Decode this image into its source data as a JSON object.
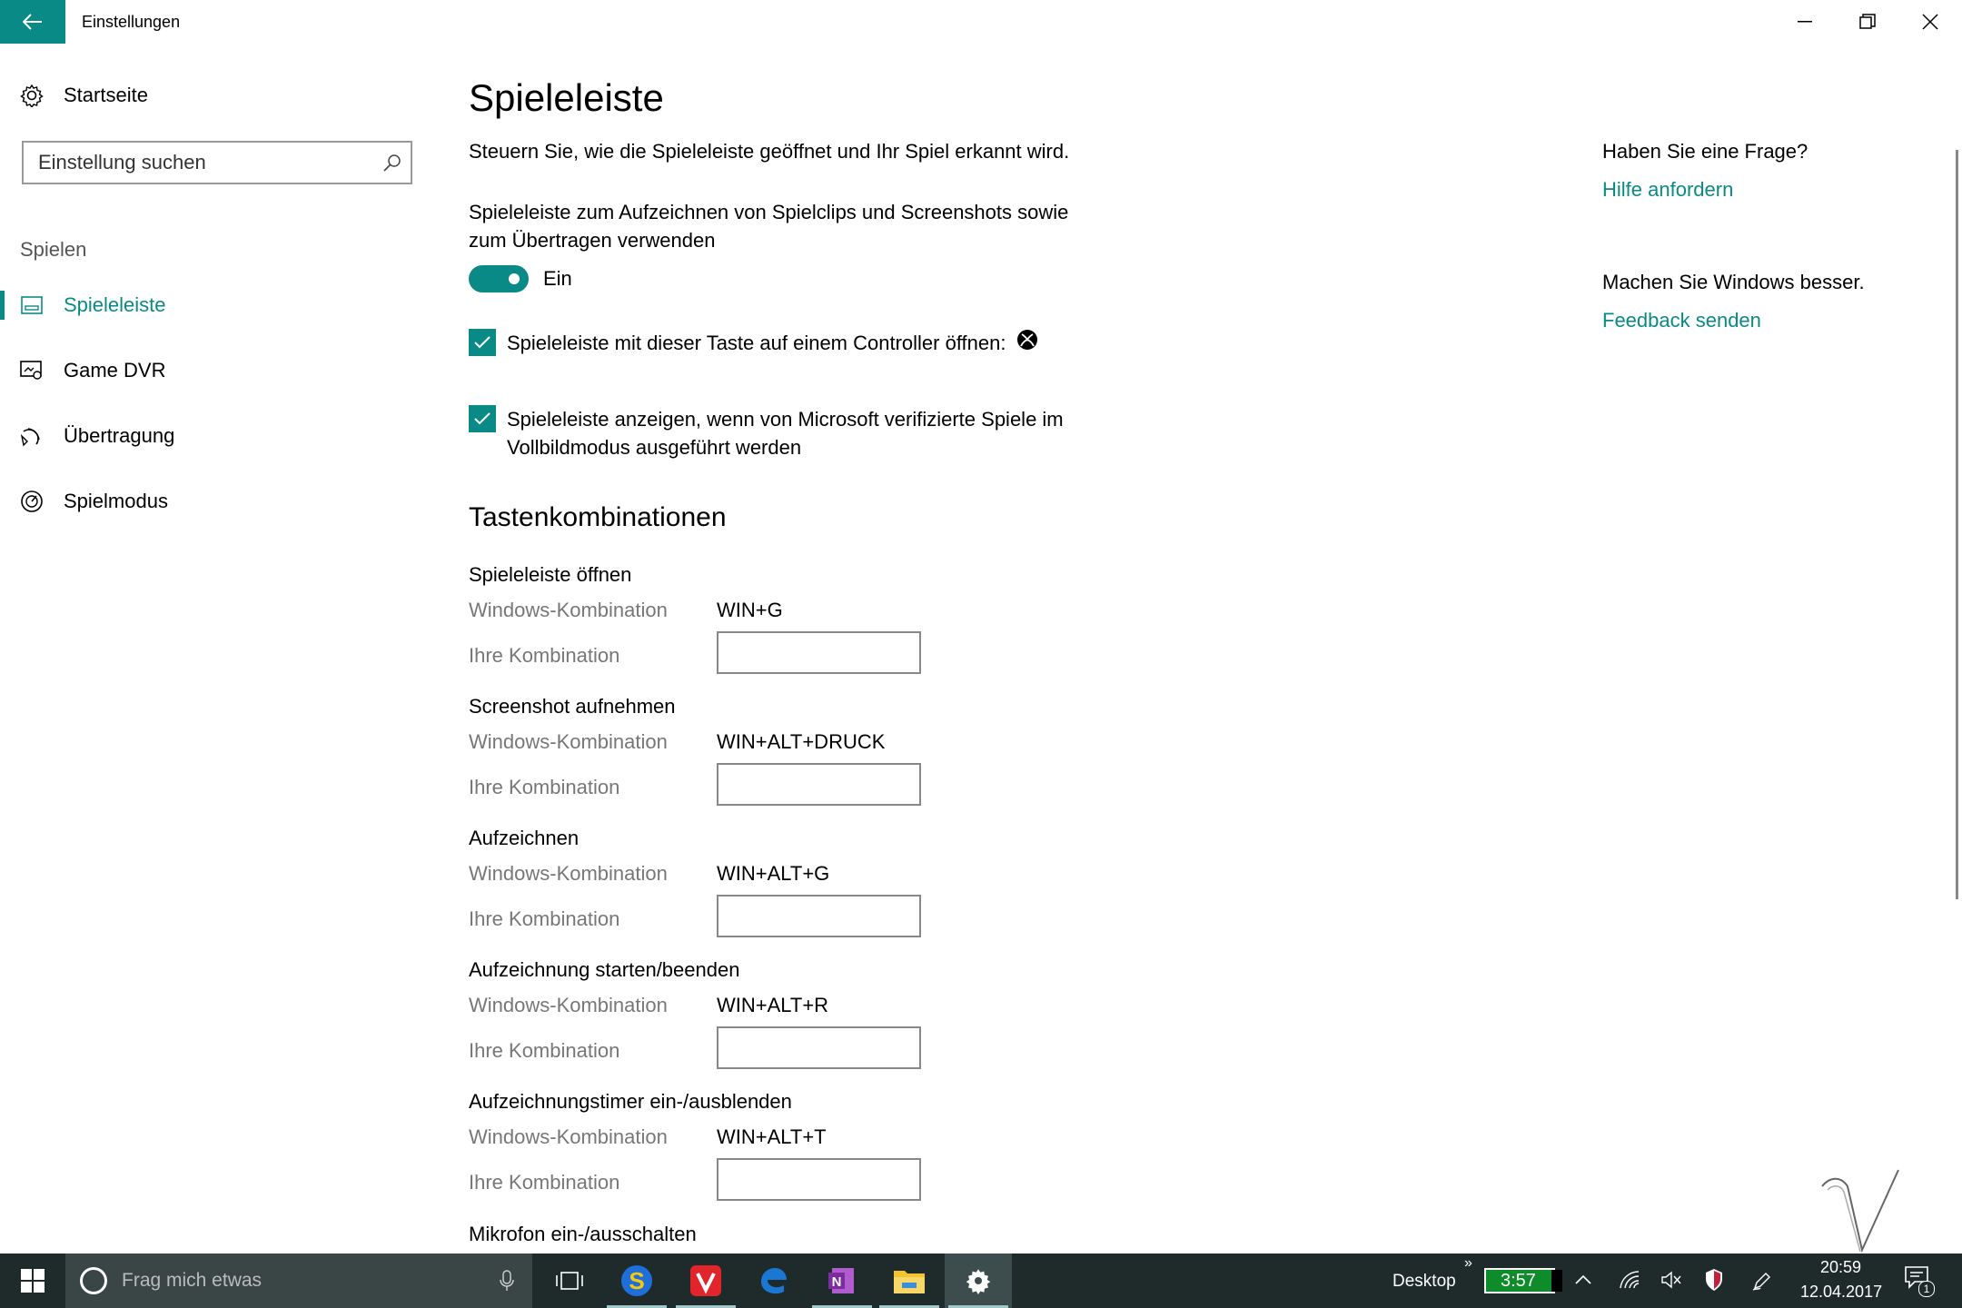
{
  "window": {
    "title": "Einstellungen"
  },
  "sidebar": {
    "home_label": "Startseite",
    "search_placeholder": "Einstellung suchen",
    "group_label": "Spielen",
    "items": [
      {
        "label": "Spieleleiste",
        "icon": "game-bar-icon",
        "active": true
      },
      {
        "label": "Game DVR",
        "icon": "game-dvr-icon",
        "active": false
      },
      {
        "label": "Übertragung",
        "icon": "broadcast-icon",
        "active": false
      },
      {
        "label": "Spielmodus",
        "icon": "game-mode-icon",
        "active": false
      }
    ]
  },
  "main": {
    "title": "Spieleleiste",
    "description": "Steuern Sie, wie die Spieleleiste geöffnet und Ihr Spiel erkannt wird.",
    "record_setting_label": "Spieleleiste zum Aufzeichnen von Spielclips und Screenshots sowie zum Übertragen verwenden",
    "toggle_state": "Ein",
    "checkbox_controller": "Spieleleiste mit dieser Taste auf einem Controller öffnen:",
    "checkbox_fullscreen": "Spieleleiste anzeigen, wenn von Microsoft verifizierte Spiele im Vollbildmodus ausgeführt werden",
    "shortcuts_title": "Tastenkombinationen",
    "windows_combo_label": "Windows-Kombination",
    "your_combo_label": "Ihre Kombination",
    "shortcuts": [
      {
        "title": "Spieleleiste öffnen",
        "windows_combo": "WIN+G",
        "your_combo": ""
      },
      {
        "title": "Screenshot aufnehmen",
        "windows_combo": "WIN+ALT+DRUCK",
        "your_combo": ""
      },
      {
        "title": "Aufzeichnen",
        "windows_combo": "WIN+ALT+G",
        "your_combo": ""
      },
      {
        "title": "Aufzeichnung starten/beenden",
        "windows_combo": "WIN+ALT+R",
        "your_combo": ""
      },
      {
        "title": "Aufzeichnungstimer ein-/ausblenden",
        "windows_combo": "WIN+ALT+T",
        "your_combo": ""
      },
      {
        "title": "Mikrofon ein-/ausschalten"
      }
    ]
  },
  "right": {
    "question": "Haben Sie eine Frage?",
    "help_link": "Hilfe anfordern",
    "improve": "Machen Sie Windows besser.",
    "feedback_link": "Feedback senden"
  },
  "taskbar": {
    "search_placeholder": "Frag mich etwas",
    "desktop_label": "Desktop",
    "battery_time": "3:57",
    "clock_time": "20:59",
    "clock_date": "12.04.2017",
    "notification_count": "1"
  },
  "colors": {
    "accent": "#0a8a86",
    "taskbar": "#1f2b2b"
  }
}
